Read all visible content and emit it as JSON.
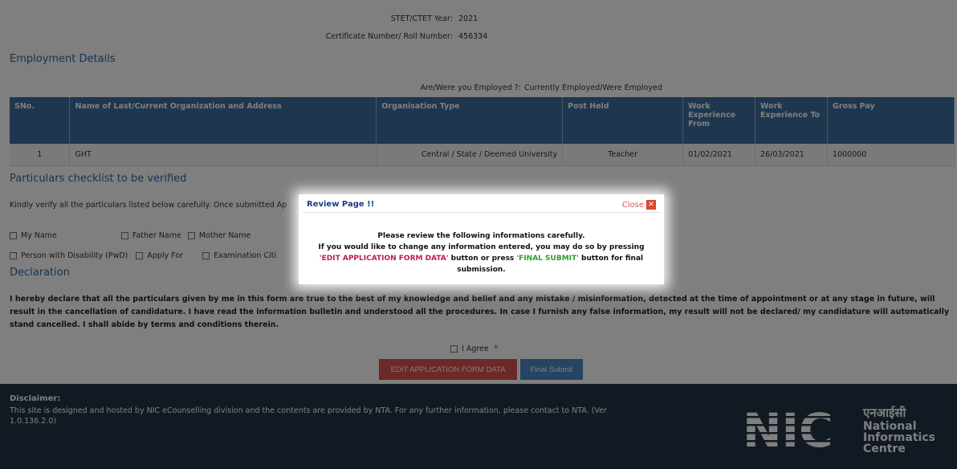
{
  "exam_info": {
    "year_label": "STET/CTET Year:",
    "year_value": "2021",
    "cert_label": "Certificate Number/ Roll Number:",
    "cert_value": "456334"
  },
  "employment": {
    "title": "Employment Details",
    "employed_label": "Are/Were you Employed ?:",
    "employed_value": "Currently Employed/Were Employed",
    "headers": [
      "SNo.",
      "Name of Last/Current Organization and Address",
      "Organisation Type",
      "Post Held",
      "Work Experience From",
      "Work Experience To",
      "Gross Pay"
    ],
    "rows": [
      [
        "1",
        "GHT",
        "Central / State / Deemed University",
        "Teacher",
        "01/02/2021",
        "26/03/2021",
        "1000000"
      ]
    ]
  },
  "checklist": {
    "title": "Particulars checklist to be verified",
    "instruction": "Kindly verify all the particulars listed below carefully. Once submitted Ap",
    "items_row1": [
      "My Name",
      "Father Name",
      "Mother Name"
    ],
    "items_row2": [
      "Person with Disability (PwD)",
      "Apply For",
      "Examination Citi"
    ]
  },
  "declaration": {
    "title": "Declaration",
    "text": "I hereby declare that all the particulars given by me in this form are true to the best of my knowledge and belief and any mistake / misinformation, detected at the time of appointment or at any stage in future, will result in the cancellation of candidature. I have read the information bulletin and understood all the procedures. In case I furnish any false information, my result will not be declared/ my candidature will automatically stand cancelled. I shall abide by terms and conditions therein.",
    "agree_label": "I Agree",
    "required_mark": "*"
  },
  "buttons": {
    "edit_label": "EDIT APPLICATION FORM DATA",
    "final_label": "Final Submit"
  },
  "footer": {
    "disclaimer_title": "Disclaimer:",
    "disclaimer_text": "This site is designed and hosted by NIC eCounselling division and the contents are provided by NTA. For any further information, please contact to NTA. (Ver 1.0.136.2.0)",
    "logo_letters": "NIC",
    "logo_hindi": "एनआईसी",
    "logo_en_1": "National",
    "logo_en_2": "Informatics",
    "logo_en_3": "Centre"
  },
  "modal": {
    "title": "Review Page !!",
    "close_label": "Close",
    "line1": "Please review the following informations carefully.",
    "line2": "If you would like to change any information entered, you may do so by pressing",
    "edit_quote": "'EDIT APPLICATION FORM DATA'",
    "or_press": " button or press ",
    "final_quote": "'FINAL SUBMIT'",
    "line3_tail": " button for final submission."
  },
  "colors": {
    "table_header": "#3d6f9e",
    "section_title": "#2c6aa0",
    "edit_button": "#d9534f",
    "final_button": "#4a8ac4",
    "footer_bg": "#233447",
    "modal_title": "#1a3e8a",
    "modal_edit_highlight": "#c2185b",
    "modal_final_highlight": "#2e9e2e"
  }
}
